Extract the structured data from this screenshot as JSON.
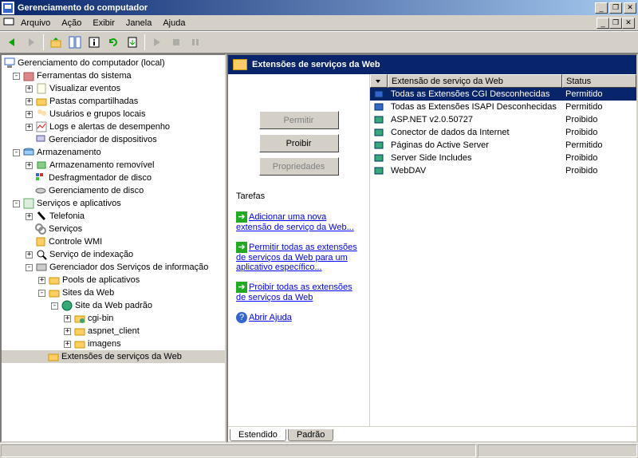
{
  "window": {
    "title": "Gerenciamento do computador"
  },
  "menu": {
    "arquivo": "Arquivo",
    "acao": "Ação",
    "exibir": "Exibir",
    "janela": "Janela",
    "ajuda": "Ajuda"
  },
  "tree": {
    "root": "Gerenciamento do computador (local)",
    "ferramentas": "Ferramentas do sistema",
    "visualizar_eventos": "Visualizar eventos",
    "pastas_comp": "Pastas compartilhadas",
    "usuarios_grupos": "Usuários e grupos locais",
    "logs_alertas": "Logs e alertas de desempenho",
    "gerenc_disp": "Gerenciador de dispositivos",
    "armazenamento": "Armazenamento",
    "armaz_rem": "Armazenamento removível",
    "desfrag": "Desfragmentador de disco",
    "gerenc_disco": "Gerenciamento de disco",
    "servicos_apps": "Serviços e aplicativos",
    "telefonia": "Telefonia",
    "servicos": "Serviços",
    "controle_wmi": "Controle WMI",
    "serv_index": "Serviço de indexação",
    "gerenc_iis": "Gerenciador dos Serviços de informação",
    "pools": "Pools de aplicativos",
    "sites_web": "Sites da Web",
    "site_padrao": "Site da Web padrão",
    "cgi_bin": "cgi-bin",
    "aspnet_client": "aspnet_client",
    "imagens": "imagens",
    "ext_serv_web": "Extensões de serviços da Web"
  },
  "pane": {
    "header": "Extensões de serviços da Web",
    "btn_permitir": "Permitir",
    "btn_proibir": "Proibir",
    "btn_props": "Propriedades",
    "tarefas": "Tarefas",
    "link_add": "Adicionar uma nova extensão de serviço da Web...",
    "link_allow": "Permitir todas as extensões de serviços da Web para um aplicativo específico...",
    "link_deny": "Proibir todas as extensões de serviços da Web",
    "link_help": "Abrir Ajuda"
  },
  "list": {
    "col_icon": "",
    "col_ext": "Extensão de serviço da Web",
    "col_status": "Status",
    "rows": [
      {
        "name": "Todas as Extensões CGI Desconhecidas",
        "status": "Permitido"
      },
      {
        "name": "Todas as Extensões ISAPI Desconhecidas",
        "status": "Permitido"
      },
      {
        "name": "ASP.NET v2.0.50727",
        "status": "Proibido"
      },
      {
        "name": "Conector de dados da Internet",
        "status": "Proibido"
      },
      {
        "name": "Páginas do Active Server",
        "status": "Permitido"
      },
      {
        "name": "Server Side Includes",
        "status": "Proibido"
      },
      {
        "name": "WebDAV",
        "status": "Proibido"
      }
    ]
  },
  "tabs": {
    "estendido": "Estendido",
    "padrao": "Padrão"
  }
}
